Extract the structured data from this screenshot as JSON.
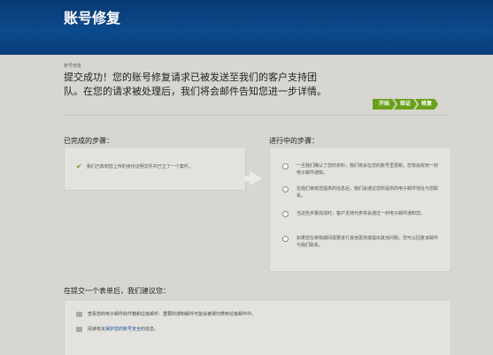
{
  "header": {
    "title": "账号修复"
  },
  "breadcrumb": "账号修复",
  "message": "提交成功！您的账号修复请求已被发送至我们的客户支持团队。在您的请求被处理后，我们将会邮件告知您进一步详情。",
  "progress": {
    "steps": [
      "开始",
      "验证",
      "修复"
    ]
  },
  "completed": {
    "title": "已完成的步骤：",
    "items": [
      "我们已收到您上传的身份证明文件并已立了一个案件。"
    ]
  },
  "in_progress": {
    "title": "进行中的步骤：",
    "items": [
      "一旦我们确认了您的资料，我们将会在您的账号里更新。您将会收到一封电子邮件通知。",
      "在我们审核您提供的信息后，我们会通过您所提供的电子邮件地址与您联系。",
      "当这些步骤完成时，客户支持代表将会通过一封电子邮件通知您。",
      "如果您在审核期间需要进行其他更改或提出其他问题，您可以回复该邮件与我们联系。"
    ]
  },
  "recommend": {
    "title": "在提交一个表单后，我们建议您：",
    "items": [
      {
        "text": "查看您的电子邮件收件箱和垃圾邮件：重要的通知邮件可能会被误归类到垃圾邮件中。",
        "link": ""
      },
      {
        "text": "阅读有关",
        "link": "保护您的账号安全",
        "suffix": "的信息。"
      }
    ]
  }
}
